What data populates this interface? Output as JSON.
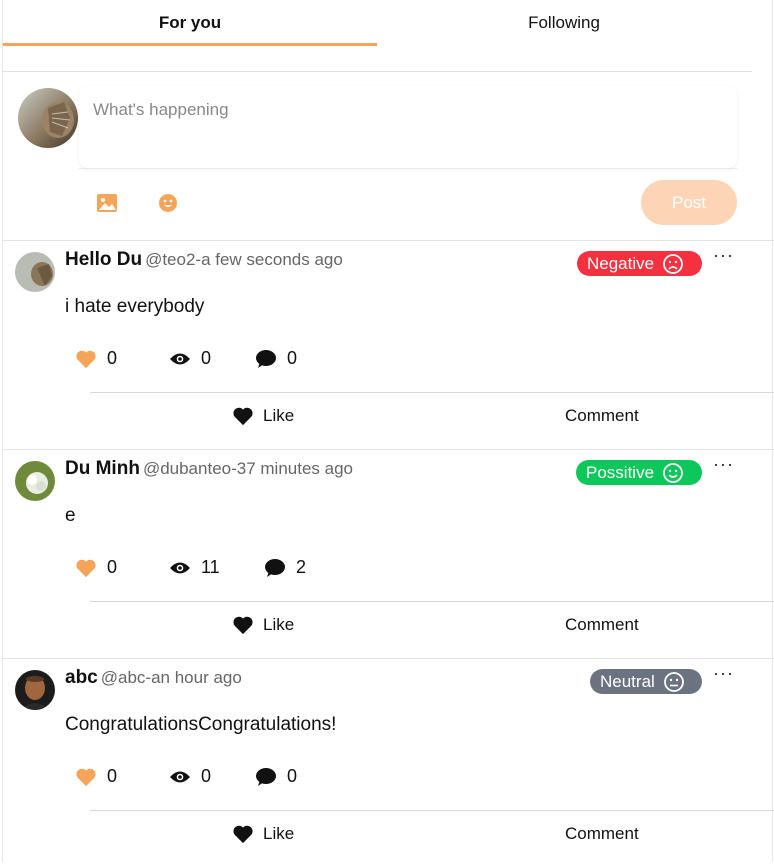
{
  "tabs": [
    {
      "label": "For you",
      "active": true
    },
    {
      "label": "Following",
      "active": false
    }
  ],
  "composer": {
    "placeholder": "What's happening",
    "post_label": "Post",
    "tools": [
      "image-icon",
      "emoji-icon"
    ]
  },
  "colors": {
    "accent": "#f5a55a",
    "post_button": "#fdd5b6",
    "negative": "#f5303f",
    "positive": "#0cc85a",
    "neutral": "#6b7280"
  },
  "posts": [
    {
      "name": "Hello Du",
      "meta": "@teo2-a few seconds ago",
      "sentiment": "Negative",
      "text": "i hate everybody",
      "likes": "0",
      "views": "0",
      "comments": "0",
      "like_label": "Like",
      "comment_label": "Comment"
    },
    {
      "name": "Du Minh",
      "meta": "@dubanteo-37 minutes ago",
      "sentiment": "Possitive",
      "text": "e",
      "likes": "0",
      "views": "11",
      "comments": "2",
      "like_label": "Like",
      "comment_label": "Comment"
    },
    {
      "name": "abc",
      "meta": "@abc-an hour ago",
      "sentiment": "Neutral",
      "text": "CongratulationsCongratulations!",
      "likes": "0",
      "views": "0",
      "comments": "0",
      "like_label": "Like",
      "comment_label": "Comment"
    }
  ]
}
